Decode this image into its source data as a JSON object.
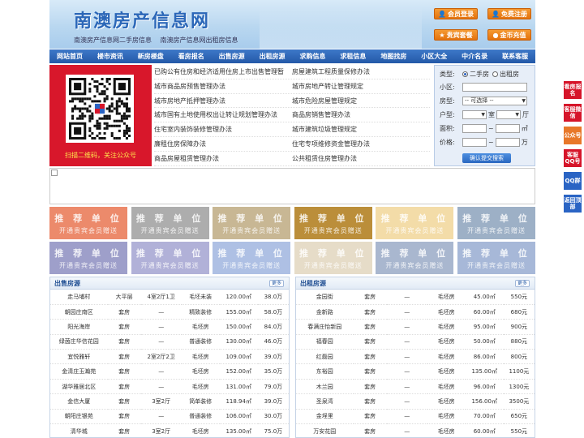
{
  "header": {
    "site_title": "南澳房产信息网",
    "sub_links": [
      "南澳房产信息网二手房信息",
      "南澳房产信息网出租房信息"
    ],
    "buttons": {
      "login": "会员登录",
      "register": "免费注册",
      "vip": "贵宾套餐",
      "recharge": "金币充值"
    }
  },
  "nav": [
    "网站首页",
    "楼市资讯",
    "新房楼盘",
    "看房报名",
    "出售房源",
    "出租房源",
    "求购信息",
    "求租信息",
    "地图找房",
    "小区大全",
    "中介名录",
    "联系客服"
  ],
  "qr": {
    "caption": "扫描二维码，关注公众号"
  },
  "links": [
    [
      "已购公有住房和经济适用住房上市出售管理暂",
      "房屋建筑工程质量保修办法"
    ],
    [
      "城市商品房预售管理办法",
      "城市房地产转让管理规定"
    ],
    [
      "城市房地产抵押管理办法",
      "城市危险房屋管理规定"
    ],
    [
      "城市国有土地使用权出让转让规划管理办法",
      "商品房销售管理办法"
    ],
    [
      "住宅室内装饰装修管理办法",
      "城市建筑垃圾管理规定"
    ],
    [
      "廉租住房保障办法",
      "住宅专项维修资金管理办法"
    ],
    [
      "商品房屋租赁管理办法",
      "公共租赁住房管理办法"
    ]
  ],
  "search": {
    "type_label": "类型:",
    "opt_sale": "二手房",
    "opt_rent": "出租房",
    "community_label": "小区:",
    "room_type_label": "房型:",
    "room_type_value": "-- 可选择 --",
    "layout_label": "户型:",
    "unit_room": "室",
    "unit_hall": "厅",
    "area_label": "面积:",
    "area_unit": "㎡",
    "price_label": "价格:",
    "price_unit": "万",
    "dash": "~",
    "submit": "确认提交搜索"
  },
  "rec": {
    "title": "推 荐 单 位",
    "subtitle": "开通贵宾会员赠送",
    "colors": [
      "#ec8a6b",
      "#adadad",
      "#c8b794",
      "#bb8e3a",
      "#f3dca8",
      "#9db0c6",
      "#9e9fca",
      "#b1b1d8",
      "#aec0e4",
      "#e6dcc8",
      "#a9b7cf",
      "#a7b8d8"
    ]
  },
  "sale": {
    "title": "出售房源",
    "more": "更多",
    "rows": [
      [
        "走马埔村",
        "大平层",
        "4室2厅1卫",
        "毛坯未装",
        "120.00㎡",
        "38.0万"
      ],
      [
        "朝园庄南区",
        "套房",
        "—",
        "精致装修",
        "155.00㎡",
        "58.0万"
      ],
      [
        "阳光海岸",
        "套房",
        "—",
        "毛坯房",
        "150.00㎡",
        "84.0万"
      ],
      [
        "绿茵庄华信花园",
        "套房",
        "—",
        "普通装修",
        "130.00㎡",
        "46.0万"
      ],
      [
        "宜悦雅轩",
        "套房",
        "2室2厅2卫",
        "毛坯房",
        "109.00㎡",
        "39.0万"
      ],
      [
        "金清庄玉瀚苑",
        "套房",
        "—",
        "毛坯房",
        "152.00㎡",
        "35.0万"
      ],
      [
        "湖华雅居北区",
        "套房",
        "—",
        "毛坯房",
        "131.00㎡",
        "79.0万"
      ],
      [
        "金信大厦",
        "套房",
        "3室2厅",
        "简单装修",
        "118.94㎡",
        "39.0万"
      ],
      [
        "朝阳庄银苑",
        "套房",
        "—",
        "普通装修",
        "106.00㎡",
        "30.0万"
      ],
      [
        "清华城",
        "套房",
        "3室2厅",
        "毛坯房",
        "135.00㎡",
        "75.0万"
      ]
    ]
  },
  "rent": {
    "title": "出租房源",
    "more": "更多",
    "rows": [
      [
        "金园街",
        "套房",
        "—",
        "毛坯房",
        "45.00㎡",
        "550元"
      ],
      [
        "金新路",
        "套房",
        "—",
        "毛坯房",
        "60.00㎡",
        "680元"
      ],
      [
        "春满庄怡新园",
        "套房",
        "—",
        "毛坯房",
        "95.00㎡",
        "900元"
      ],
      [
        "福春园",
        "套房",
        "—",
        "毛坯房",
        "50.00㎡",
        "880元"
      ],
      [
        "红磊园",
        "套房",
        "—",
        "毛坯房",
        "86.00㎡",
        "800元"
      ],
      [
        "东裕园",
        "套房",
        "—",
        "毛坯房",
        "135.00㎡",
        "1100元"
      ],
      [
        "木兰园",
        "套房",
        "—",
        "毛坯房",
        "96.00㎡",
        "1300元"
      ],
      [
        "圣泉湾",
        "套房",
        "—",
        "毛坯房",
        "156.00㎡",
        "3500元"
      ],
      [
        "金埕里",
        "套房",
        "—",
        "毛坯房",
        "70.00㎡",
        "650元"
      ],
      [
        "万安花园",
        "套房",
        "—",
        "毛坯房",
        "60.00㎡",
        "550元"
      ]
    ]
  },
  "side": [
    {
      "label": "看房报名",
      "color": "#d6152a"
    },
    {
      "label": "客服微信",
      "color": "#d6152a"
    },
    {
      "label": "公众号",
      "color": "#e8782a"
    },
    {
      "label": "客服QQ号",
      "color": "#d6152a"
    },
    {
      "label": "QQ群",
      "color": "#2a64c4"
    },
    {
      "label": "返回顶部",
      "color": "#2a64c4"
    }
  ]
}
